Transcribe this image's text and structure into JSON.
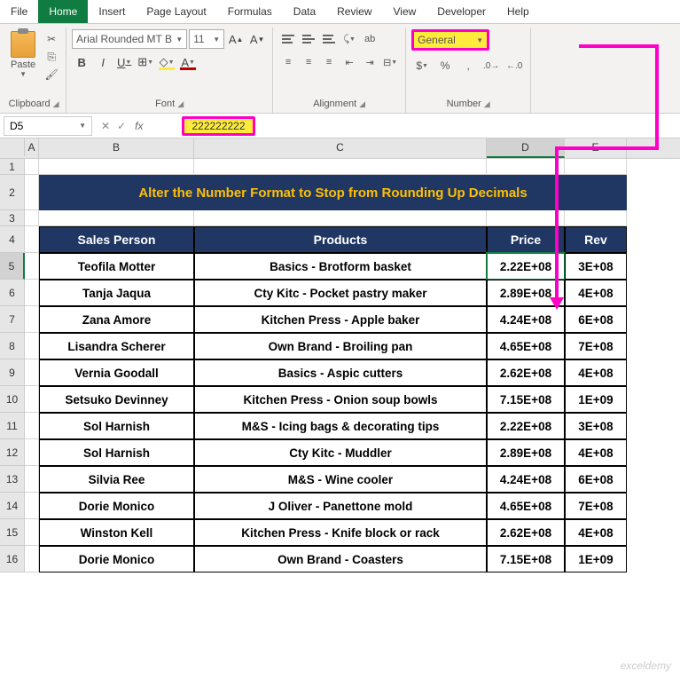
{
  "tabs": [
    "File",
    "Home",
    "Insert",
    "Page Layout",
    "Formulas",
    "Data",
    "Review",
    "View",
    "Developer",
    "Help"
  ],
  "clipboard": {
    "paste": "Paste",
    "label": "Clipboard"
  },
  "font": {
    "name": "Arial Rounded MT B",
    "size": "11",
    "label": "Font"
  },
  "alignment": {
    "label": "Alignment"
  },
  "number": {
    "format": "General",
    "label": "Number"
  },
  "fbar": {
    "cell": "D5",
    "fx": "fx",
    "value": "222222222"
  },
  "cols": [
    "A",
    "B",
    "C",
    "D",
    "E"
  ],
  "title": "Alter the Number Format to Stop from Rounding Up Decimals",
  "headers": {
    "b": "Sales Person",
    "c": "Products",
    "d": "Price",
    "e": "Rev"
  },
  "rows": [
    {
      "n": "5",
      "b": "Teofila Motter",
      "c": "Basics - Brotform basket",
      "d": "2.22E+08",
      "e": "3E+08"
    },
    {
      "n": "6",
      "b": "Tanja Jaqua",
      "c": "Cty Kitc - Pocket pastry maker",
      "d": "2.89E+08",
      "e": "4E+08"
    },
    {
      "n": "7",
      "b": "Zana Amore",
      "c": "Kitchen Press - Apple baker",
      "d": "4.24E+08",
      "e": "6E+08"
    },
    {
      "n": "8",
      "b": "Lisandra Scherer",
      "c": "Own Brand - Broiling pan",
      "d": "4.65E+08",
      "e": "7E+08"
    },
    {
      "n": "9",
      "b": "Vernia Goodall",
      "c": "Basics - Aspic cutters",
      "d": "2.62E+08",
      "e": "4E+08"
    },
    {
      "n": "10",
      "b": "Setsuko Devinney",
      "c": "Kitchen Press - Onion soup bowls",
      "d": "7.15E+08",
      "e": "1E+09"
    },
    {
      "n": "11",
      "b": "Sol Harnish",
      "c": "M&S - Icing bags & decorating tips",
      "d": "2.22E+08",
      "e": "3E+08"
    },
    {
      "n": "12",
      "b": "Sol Harnish",
      "c": "Cty Kitc - Muddler",
      "d": "2.89E+08",
      "e": "4E+08"
    },
    {
      "n": "13",
      "b": "Silvia Ree",
      "c": "M&S - Wine cooler",
      "d": "4.24E+08",
      "e": "6E+08"
    },
    {
      "n": "14",
      "b": "Dorie Monico",
      "c": "J Oliver - Panettone mold",
      "d": "4.65E+08",
      "e": "7E+08"
    },
    {
      "n": "15",
      "b": "Winston Kell",
      "c": "Kitchen Press - Knife block or rack",
      "d": "2.62E+08",
      "e": "4E+08"
    },
    {
      "n": "16",
      "b": "Dorie Monico",
      "c": "Own Brand - Coasters",
      "d": "7.15E+08",
      "e": "1E+09"
    }
  ],
  "watermark": "exceldemy"
}
